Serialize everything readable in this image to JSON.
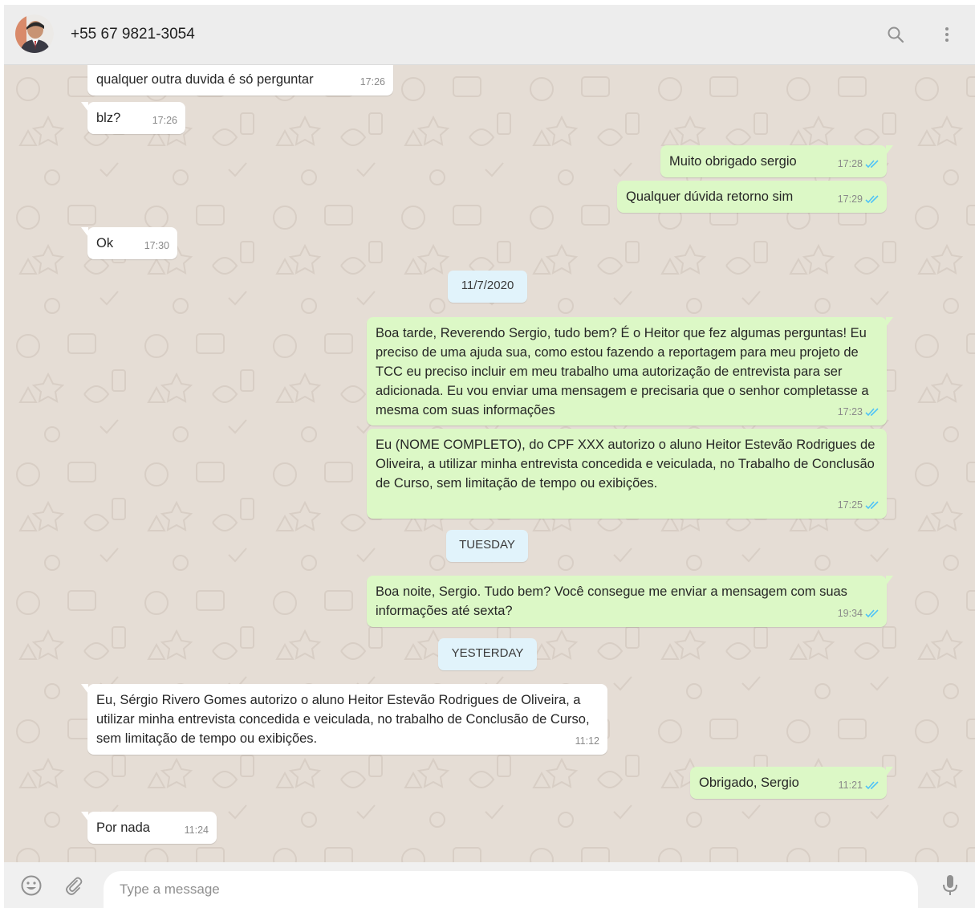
{
  "header": {
    "contact_name": "+55 67 9821-3054",
    "icons": [
      "search-icon",
      "menu-dots-icon"
    ]
  },
  "messages": [
    {
      "dir": "in",
      "text": "qualquer outra duvida é só perguntar",
      "time": "17:26"
    },
    {
      "dir": "in",
      "text": "blz?",
      "time": "17:26"
    },
    {
      "dir": "out",
      "text": "Muito obrigado sergio",
      "time": "17:28",
      "status": "read"
    },
    {
      "dir": "out",
      "text": "Qualquer dúvida retorno sim",
      "time": "17:29",
      "status": "read"
    },
    {
      "dir": "in",
      "text": "Ok",
      "time": "17:30"
    },
    {
      "dir": "date",
      "text": "11/7/2020"
    },
    {
      "dir": "out",
      "text": "Boa tarde, Reverendo Sergio, tudo bem? É o Heitor que fez algumas perguntas! Eu preciso de uma ajuda sua, como estou fazendo a reportagem para meu projeto de TCC eu preciso incluir em meu trabalho uma autorização de entrevista para ser adicionada. Eu vou enviar uma mensagem e precisaria que o senhor completasse a mesma com suas informações",
      "time": "17:23",
      "status": "read"
    },
    {
      "dir": "out",
      "text": "Eu (NOME COMPLETO), do CPF XXX autorizo o aluno Heitor Estevão Rodrigues de Oliveira, a utilizar minha entrevista concedida e veiculada, no Trabalho de Conclusão de Curso, sem limitação de tempo ou exibições.",
      "time": "17:25",
      "status": "read"
    },
    {
      "dir": "date",
      "text": "TUESDAY"
    },
    {
      "dir": "out",
      "text": "Boa noite, Sergio. Tudo bem? Você consegue me enviar a mensagem com suas informações até sexta?",
      "time": "19:34",
      "status": "read"
    },
    {
      "dir": "date",
      "text": "YESTERDAY"
    },
    {
      "dir": "in",
      "text": "Eu, Sérgio Rivero Gomes autorizo o aluno Heitor Estevão Rodrigues de Oliveira, a utilizar minha entrevista concedida e veiculada, no trabalho de Conclusão de Curso, sem limitação de tempo ou exibições.",
      "time": "11:12"
    },
    {
      "dir": "out",
      "text": "Obrigado, Sergio",
      "time": "11:21",
      "status": "read"
    },
    {
      "dir": "in",
      "text": "Por nada",
      "time": "11:24"
    }
  ],
  "composer": {
    "placeholder": "Type a message",
    "value": "",
    "icons": [
      "emoji-icon",
      "attach-icon",
      "microphone-icon"
    ]
  },
  "colors": {
    "chat_background": "#e5ddd5",
    "incoming_bubble": "#ffffff",
    "outgoing_bubble": "#dcf8c6",
    "date_chip": "#e1f3fb",
    "read_tick": "#4fc3f7",
    "header_background": "#ededed"
  }
}
